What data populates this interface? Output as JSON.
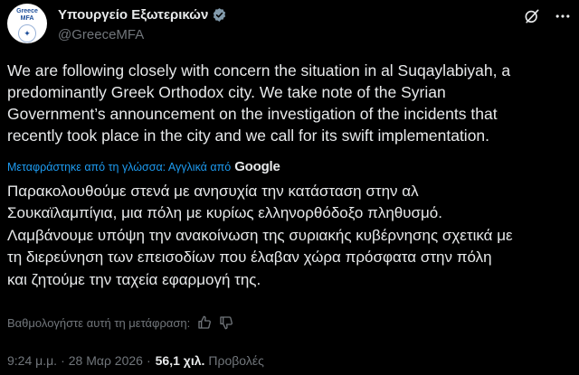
{
  "account": {
    "display_name": "Υπουργείο Εξωτερικών",
    "handle": "@GreeceMFA",
    "avatar_line1": "Greece",
    "avatar_line2": "MFA"
  },
  "tweet": {
    "text": "We are following closely with concern the situation in al Suqaylabiyah, a\npredominantly Greek Orthodox city. We take note of the Syrian\nGovernment’s announcement on the investigation of the incidents that\nrecently took place in the city and we call for its swift implementation."
  },
  "translation": {
    "label": "Μεταφράστηκε από τη γλώσσα: Αγγλικά από",
    "provider": "Google",
    "text": "Παρακολουθούμε στενά με ανησυχία την κατάσταση στην αλ\nΣουκαϊλαμπίγια, μια πόλη με κυρίως ελληνορθόδοξο πληθυσμό.\nΛαμβάνουμε υπόψη την ανακοίνωση της συριακής κυβέρνησης σχετικά με\nτη διερεύνηση των επεισοδίων που έλαβαν χώρα πρόσφατα στην πόλη\nκαι ζητούμε την ταχεία εφαρμογή της.",
    "rate_prompt": "Βαθμολογήστε αυτή τη μετάφραση:"
  },
  "meta": {
    "time": "9:24 μ.μ.",
    "separator": "·",
    "date": "28 Μαρ 2026",
    "views_count": "56,1 χιλ.",
    "views_label": "Προβολές"
  },
  "colors": {
    "background": "#000000",
    "text": "#e7e9ea",
    "secondary": "#71767b",
    "link": "#1d9bf0",
    "verified_badge": "#829aab"
  },
  "icons": [
    "verified-badge-icon",
    "grok-icon",
    "more-icon",
    "thumbs-up-icon",
    "thumbs-down-icon"
  ]
}
